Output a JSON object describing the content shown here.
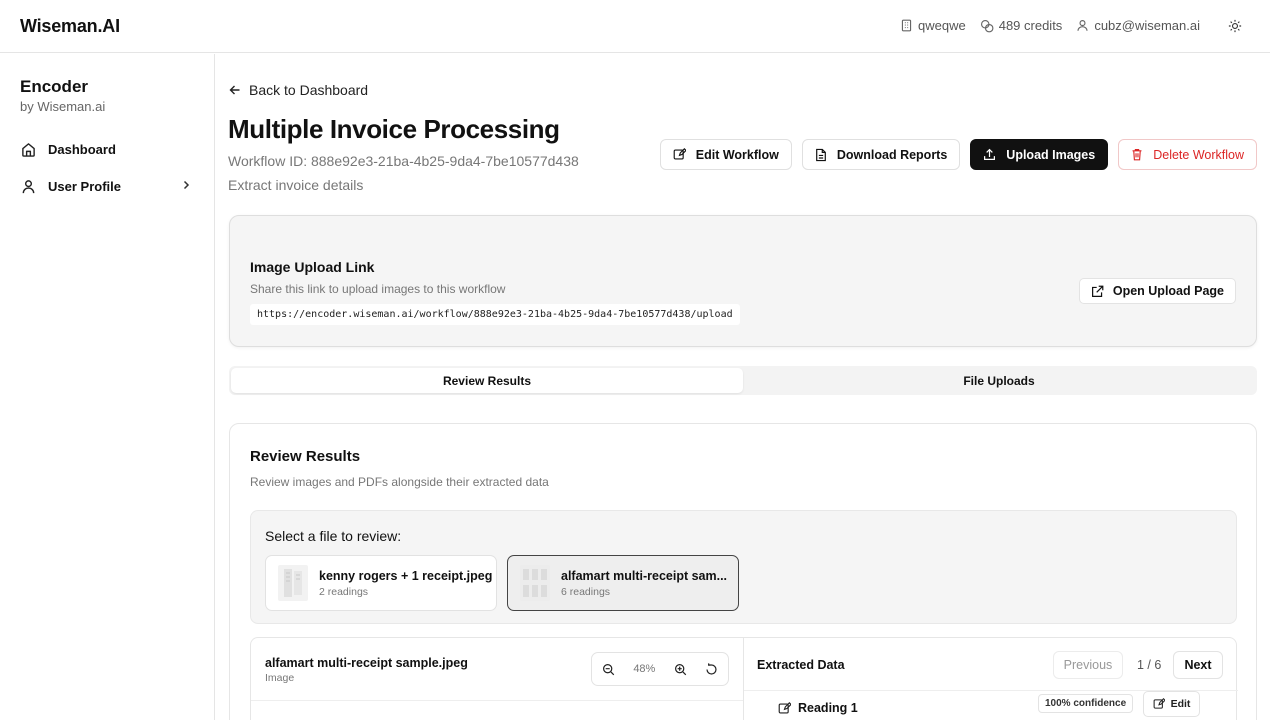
{
  "app": {
    "brand": "Wiseman.AI",
    "workspace": "qweqwe",
    "credits": "489 credits",
    "user_email": "cubz@wiseman.ai",
    "icons": {
      "workspace": "building-icon",
      "credits": "coins-icon",
      "user": "user-icon",
      "theme": "sun-icon"
    }
  },
  "sidebar": {
    "title": "Encoder",
    "subtitle": "by Wiseman.ai",
    "items": [
      {
        "label": "Dashboard",
        "icon": "home-icon"
      },
      {
        "label": "User Profile",
        "icon": "user-icon",
        "has_chevron": true
      }
    ]
  },
  "main": {
    "back_label": "Back to Dashboard",
    "title": "Multiple Invoice Processing",
    "workflow_id": "Workflow ID: 888e92e3-21ba-4b25-9da4-7be10577d438",
    "description": "Extract invoice details",
    "actions": {
      "edit": "Edit Workflow",
      "download": "Download Reports",
      "upload": "Upload Images",
      "delete": "Delete Workflow"
    },
    "upload_link": {
      "title": "Image Upload Link",
      "subtitle": "Share this link to upload images to this workflow",
      "url": "https://encoder.wiseman.ai/workflow/888e92e3-21ba-4b25-9da4-7be10577d438/upload",
      "open_label": "Open Upload Page"
    },
    "tabs": [
      {
        "label": "Review Results",
        "active": true
      },
      {
        "label": "File Uploads",
        "active": false
      }
    ],
    "review": {
      "title": "Review Results",
      "subtitle": "Review images and PDFs alongside their extracted data",
      "select_label": "Select a file to review:",
      "files": [
        {
          "name": "kenny rogers + 1 receipt.jpeg",
          "count": "2 readings",
          "selected": false
        },
        {
          "name": "alfamart multi-receipt sam...",
          "count": "6 readings",
          "selected": true
        }
      ],
      "viewer": {
        "file_name": "alfamart multi-receipt sample.jpeg",
        "file_type": "Image",
        "zoom": "48%"
      },
      "extracted": {
        "title": "Extracted Data",
        "previous": "Previous",
        "page": "1 / 6",
        "next": "Next",
        "reading": "Reading 1",
        "confidence": "100% confidence",
        "edit": "Edit"
      }
    }
  },
  "colors": {
    "primary": "#111111",
    "danger": "#dc2626",
    "muted": "#777777"
  }
}
